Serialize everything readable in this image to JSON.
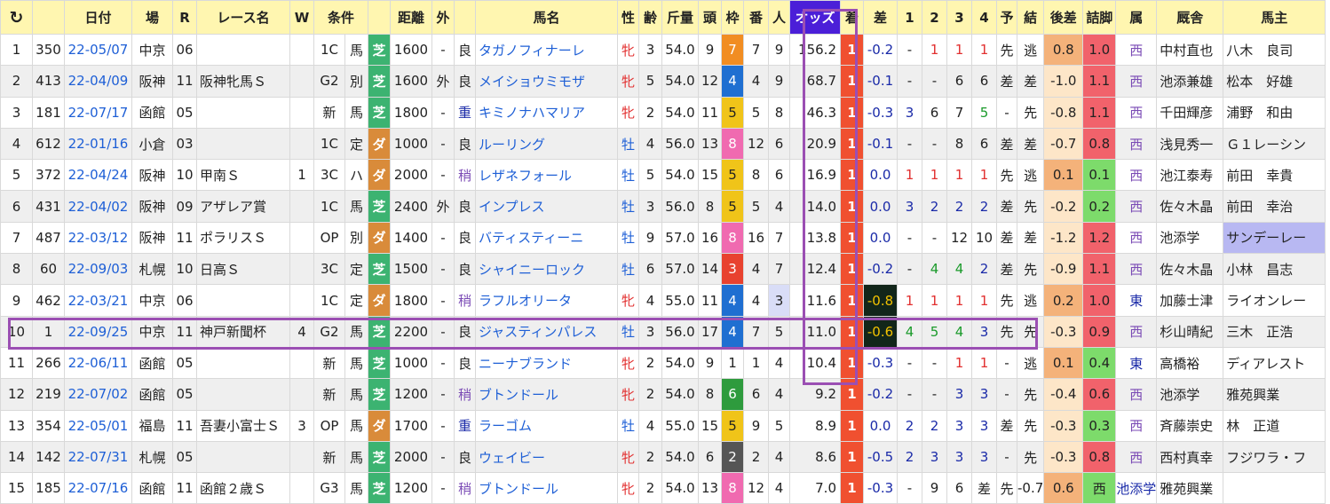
{
  "header": {
    "refresh": "↻",
    "date": "日付",
    "place": "場",
    "race": "R",
    "race_name": "レース名",
    "w": "W",
    "cond": "条件",
    "dist": "距離",
    "outer": "外",
    "horse": "馬名",
    "sex": "性",
    "age": "齢",
    "weight": "斤量",
    "heads": "頭",
    "waku": "枠",
    "num": "番",
    "ninki": "人",
    "odds": "オッズ",
    "chaku": "着",
    "diff": "差",
    "c1": "1",
    "c2": "2",
    "c3": "3",
    "c4": "4",
    "pred": "予",
    "result": "結",
    "kosa": "後差",
    "tsume": "詰脚",
    "zoku": "属",
    "kyusha": "厩舎",
    "owner": "馬主"
  },
  "rows": [
    [
      "1",
      "350",
      "22-05/07",
      "中京",
      "06",
      "",
      "",
      "1C",
      "馬",
      "芝",
      "1600",
      "-",
      "良",
      "タガノフィナーレ",
      "牝",
      "3",
      "54.0",
      "9",
      "7",
      "7",
      "9",
      "156.2",
      "1",
      "-0.2",
      "-",
      "1",
      "1",
      "1",
      "先",
      "逃",
      "0.8",
      "1.0",
      "西",
      "中村直也",
      "八木　良司"
    ],
    [
      "2",
      "413",
      "22-04/09",
      "阪神",
      "11",
      "阪神牝馬Ｓ",
      "",
      "G2",
      "別",
      "芝",
      "1600",
      "外",
      "良",
      "メイショウミモザ",
      "牝",
      "5",
      "54.0",
      "12",
      "4",
      "4",
      "9",
      "68.7",
      "1",
      "-0.1",
      "-",
      "-",
      "6",
      "6",
      "差",
      "差",
      "-1.0",
      "1.1",
      "西",
      "池添兼雄",
      "松本　好雄"
    ],
    [
      "3",
      "181",
      "22-07/17",
      "函館",
      "05",
      "",
      "",
      "新",
      "馬",
      "芝",
      "1800",
      "-",
      "重",
      "キミノナハマリア",
      "牝",
      "2",
      "54.0",
      "11",
      "5",
      "5",
      "8",
      "46.3",
      "1",
      "-0.3",
      "3",
      "6",
      "7",
      "5",
      "-",
      "先",
      "-0.8",
      "1.1",
      "西",
      "千田輝彦",
      "浦野　和由"
    ],
    [
      "4",
      "612",
      "22-01/16",
      "小倉",
      "03",
      "",
      "",
      "1C",
      "定",
      "ダ",
      "1000",
      "-",
      "良",
      "ルーリング",
      "牡",
      "4",
      "56.0",
      "13",
      "8",
      "12",
      "6",
      "20.9",
      "1",
      "-0.1",
      "-",
      "-",
      "8",
      "6",
      "差",
      "差",
      "-0.7",
      "0.8",
      "西",
      "浅見秀一",
      "Ｇ１レーシン"
    ],
    [
      "5",
      "372",
      "22-04/24",
      "阪神",
      "10",
      "甲南Ｓ",
      "1",
      "3C",
      "ハ",
      "ダ",
      "2000",
      "-",
      "稍",
      "レザネフォール",
      "牡",
      "5",
      "54.0",
      "15",
      "5",
      "8",
      "6",
      "16.9",
      "1",
      "0.0",
      "1",
      "1",
      "1",
      "1",
      "先",
      "逃",
      "0.1",
      "0.1",
      "西",
      "池江泰寿",
      "前田　幸貴"
    ],
    [
      "6",
      "431",
      "22-04/02",
      "阪神",
      "09",
      "アザレア賞",
      "",
      "1C",
      "馬",
      "芝",
      "2400",
      "外",
      "良",
      "インプレス",
      "牡",
      "3",
      "56.0",
      "8",
      "5",
      "5",
      "4",
      "14.0",
      "1",
      "0.0",
      "3",
      "2",
      "2",
      "2",
      "差",
      "先",
      "-0.2",
      "0.2",
      "西",
      "佐々木晶",
      "前田　幸治"
    ],
    [
      "7",
      "487",
      "22-03/12",
      "阪神",
      "11",
      "ポラリスＳ",
      "",
      "OP",
      "別",
      "ダ",
      "1400",
      "-",
      "良",
      "バティスティーニ",
      "牡",
      "9",
      "57.0",
      "16",
      "8",
      "16",
      "7",
      "13.8",
      "1",
      "0.0",
      "-",
      "-",
      "12",
      "10",
      "差",
      "差",
      "-1.2",
      "1.2",
      "西",
      "池添学",
      "サンデーレー"
    ],
    [
      "8",
      "60",
      "22-09/03",
      "札幌",
      "10",
      "日高Ｓ",
      "",
      "3C",
      "定",
      "芝",
      "1500",
      "-",
      "良",
      "シャイニーロック",
      "牡",
      "6",
      "57.0",
      "14",
      "3",
      "4",
      "7",
      "12.4",
      "1",
      "-0.2",
      "-",
      "4",
      "4",
      "2",
      "差",
      "先",
      "-0.9",
      "1.1",
      "西",
      "佐々木晶",
      "小林　昌志"
    ],
    [
      "9",
      "462",
      "22-03/21",
      "中京",
      "06",
      "",
      "",
      "1C",
      "定",
      "ダ",
      "1800",
      "-",
      "稍",
      "ラフルオリータ",
      "牝",
      "4",
      "55.0",
      "11",
      "4",
      "4",
      "3",
      "11.6",
      "1",
      "-0.8",
      "1",
      "1",
      "1",
      "1",
      "先",
      "逃",
      "0.2",
      "1.0",
      "東",
      "加藤士津",
      "ライオンレー"
    ],
    [
      "10",
      "1",
      "22-09/25",
      "中京",
      "11",
      "神戸新聞杯",
      "4",
      "G2",
      "馬",
      "芝",
      "2200",
      "-",
      "良",
      "ジャスティンパレス",
      "牡",
      "3",
      "56.0",
      "17",
      "4",
      "7",
      "5",
      "11.0",
      "1",
      "-0.6",
      "4",
      "5",
      "4",
      "3",
      "先",
      "先",
      "-0.3",
      "0.9",
      "西",
      "杉山晴紀",
      "三木　正浩"
    ],
    [
      "11",
      "266",
      "22-06/11",
      "函館",
      "05",
      "",
      "",
      "新",
      "馬",
      "芝",
      "1000",
      "-",
      "良",
      "ニーナブランド",
      "牝",
      "2",
      "54.0",
      "9",
      "1",
      "1",
      "4",
      "10.4",
      "1",
      "-0.3",
      "-",
      "-",
      "1",
      "1",
      "-",
      "逃",
      "0.1",
      "0.4",
      "東",
      "高橋裕",
      "ディアレスト"
    ],
    [
      "12",
      "219",
      "22-07/02",
      "函館",
      "05",
      "",
      "",
      "新",
      "馬",
      "芝",
      "1200",
      "-",
      "稍",
      "ブトンドール",
      "牝",
      "2",
      "54.0",
      "8",
      "6",
      "6",
      "4",
      "9.2",
      "1",
      "-0.2",
      "-",
      "-",
      "3",
      "3",
      "-",
      "先",
      "-0.4",
      "0.6",
      "西",
      "池添学",
      "雅苑興業"
    ],
    [
      "13",
      "354",
      "22-05/01",
      "福島",
      "11",
      "吾妻小富士Ｓ",
      "3",
      "OP",
      "馬",
      "ダ",
      "1700",
      "-",
      "重",
      "ラーゴム",
      "牡",
      "4",
      "55.0",
      "15",
      "5",
      "9",
      "5",
      "8.9",
      "1",
      "0.0",
      "2",
      "2",
      "3",
      "3",
      "差",
      "先",
      "-0.3",
      "0.3",
      "西",
      "斉藤崇史",
      "林　正道"
    ],
    [
      "14",
      "142",
      "22-07/31",
      "札幌",
      "05",
      "",
      "",
      "新",
      "馬",
      "芝",
      "2000",
      "-",
      "良",
      "ウェイビー",
      "牝",
      "2",
      "54.0",
      "6",
      "2",
      "2",
      "4",
      "8.6",
      "1",
      "-0.5",
      "2",
      "3",
      "3",
      "3",
      "-",
      "先",
      "-0.3",
      "0.8",
      "西",
      "西村真幸",
      "フジワラ・フ"
    ],
    [
      "15",
      "185",
      "22-07/16",
      "函館",
      "11",
      "函館２歳Ｓ",
      "",
      "G3",
      "馬",
      "芝",
      "1200",
      "-",
      "稍",
      "ブトンドール",
      "牝",
      "2",
      "54.0",
      "13",
      "8",
      "12",
      "4",
      "7.0",
      "1",
      "-0.3",
      "-",
      "9",
      "6",
      "差",
      "先",
      "-0.7",
      "0.6",
      "西",
      "池添学",
      "雅苑興業",
      ""
    ]
  ]
}
